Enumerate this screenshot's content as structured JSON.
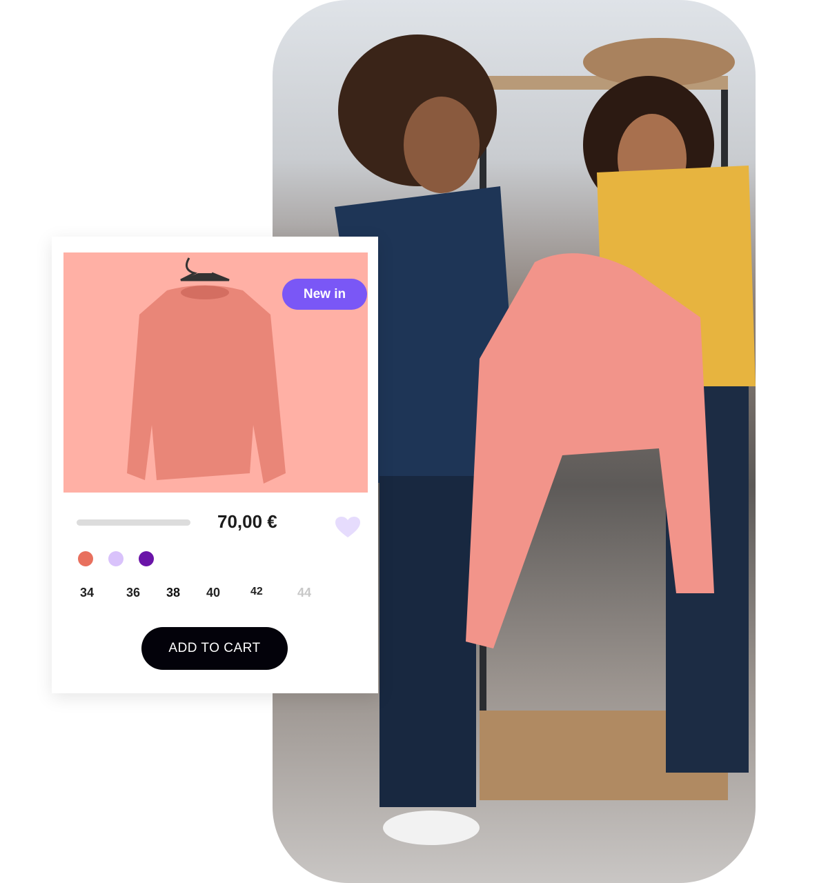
{
  "product": {
    "badge": "New in",
    "price": "70,00 €",
    "image_bg": "#ffb0a5",
    "colors": [
      "#e8705e",
      "#d9c2fb",
      "#6a14a8"
    ],
    "sizes": [
      {
        "label": "34",
        "available": true
      },
      {
        "label": "36",
        "available": true
      },
      {
        "label": "38",
        "available": true
      },
      {
        "label": "40",
        "available": true
      },
      {
        "label": "42",
        "available": true
      },
      {
        "label": "44",
        "available": false
      }
    ],
    "add_to_cart": "ADD TO CART",
    "favorite_icon": "heart-icon"
  }
}
